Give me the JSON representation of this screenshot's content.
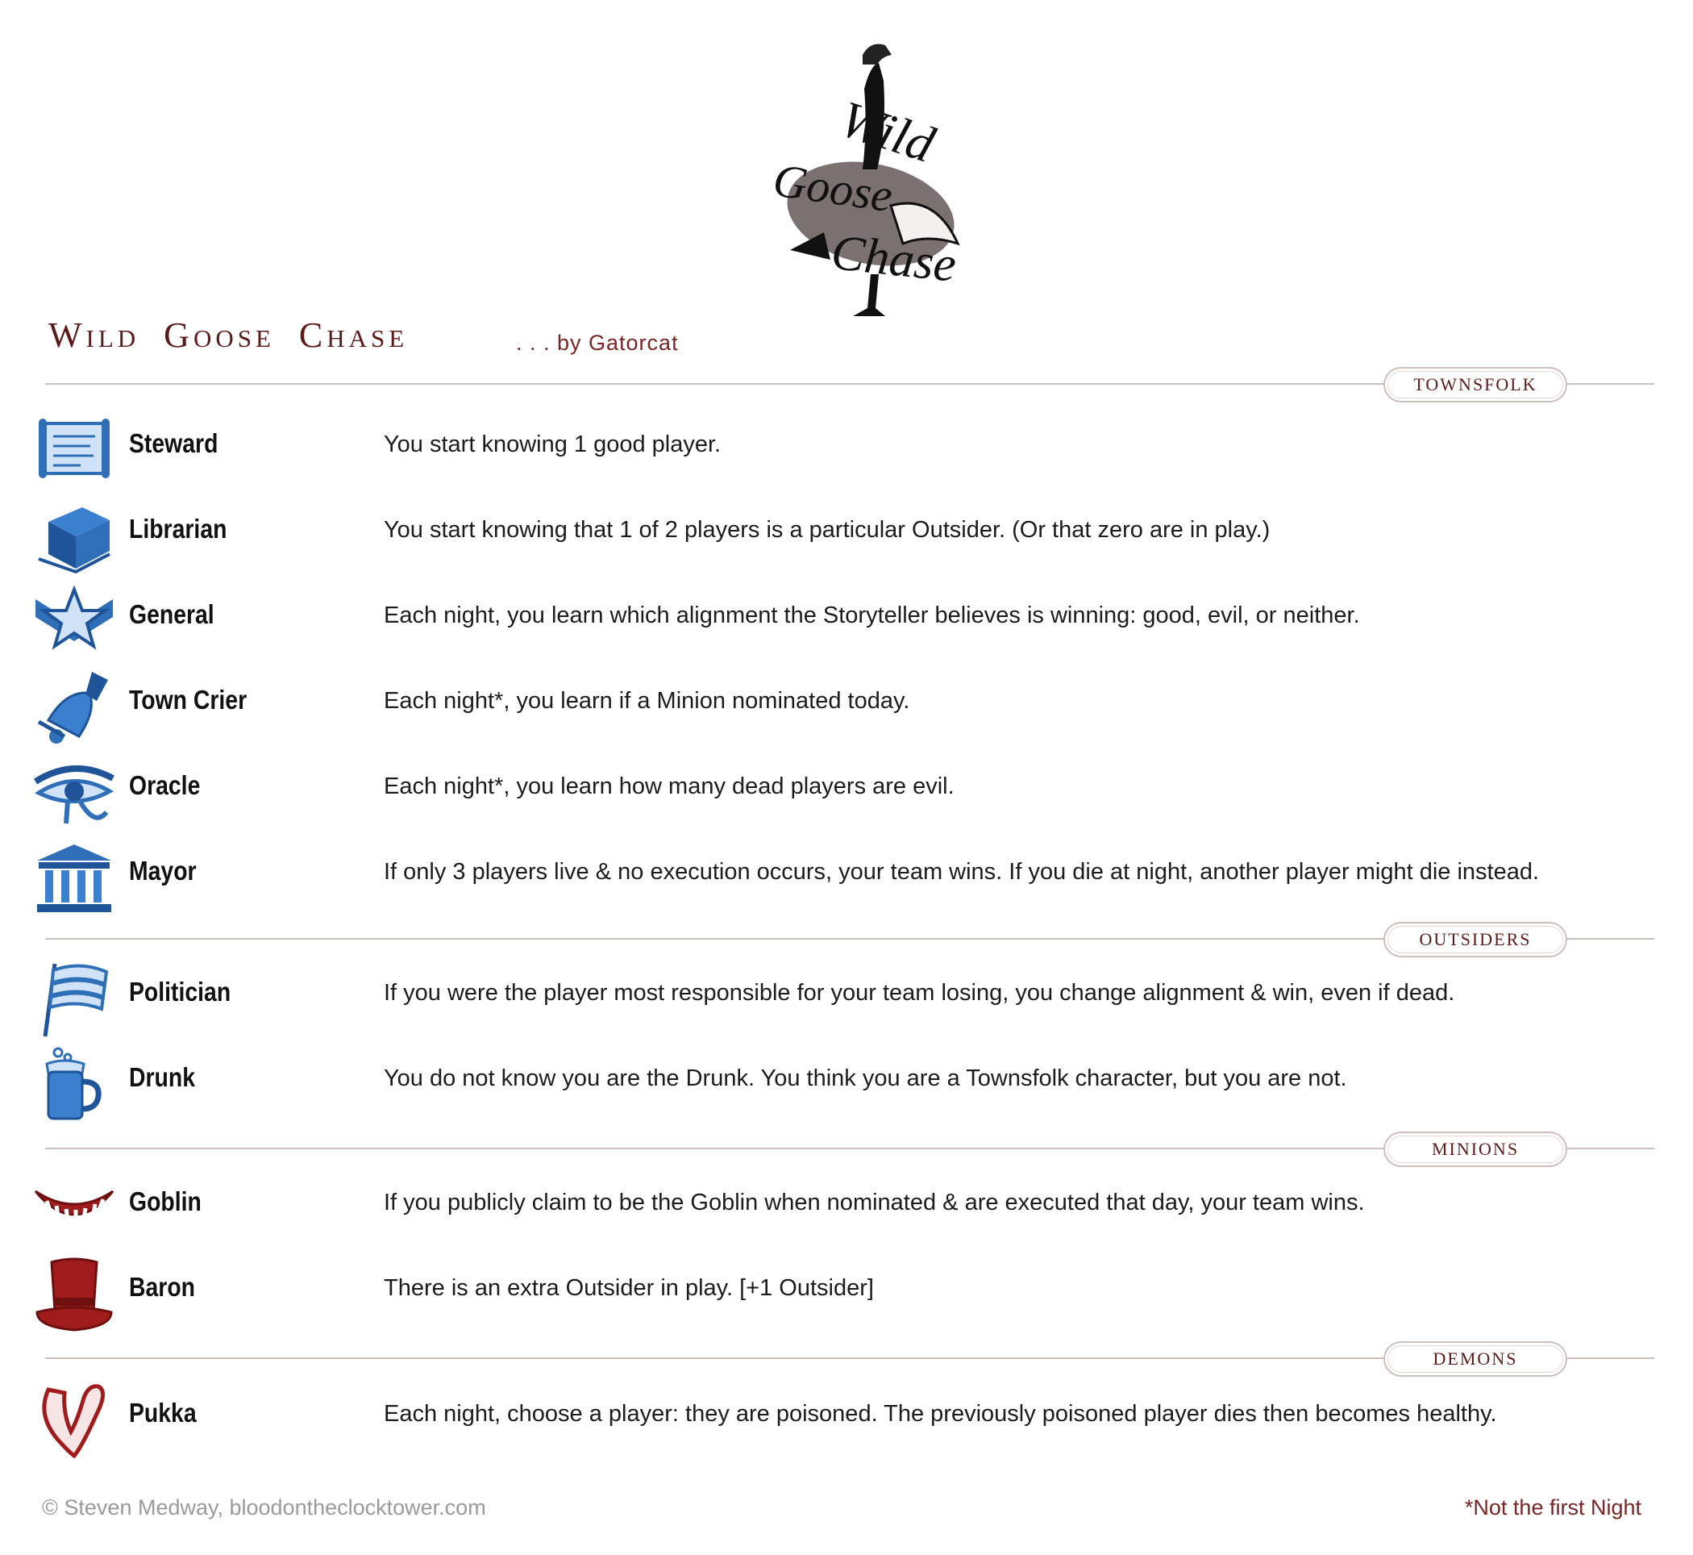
{
  "logo": {
    "text_lines": [
      "Wild",
      "Goose",
      "Chase"
    ]
  },
  "header": {
    "title": "Wild Goose Chase",
    "byline": ". . . by Gatorcat"
  },
  "teams": [
    {
      "label": "Townsfolk",
      "characters": [
        {
          "name": "Steward",
          "ability": "You start knowing 1 good player.",
          "icon": "scroll-icon",
          "color": "#2f6fb8"
        },
        {
          "name": "Librarian",
          "ability": "You start knowing that 1 of 2 players is a particular Outsider. (Or that zero are in play.)",
          "icon": "book-icon",
          "color": "#2f6fb8"
        },
        {
          "name": "General",
          "ability": "Each night, you learn which alignment the Storyteller believes is winning: good, evil, or neither.",
          "icon": "star-chevron-icon",
          "color": "#2f6fb8"
        },
        {
          "name": "Town Crier",
          "ability": "Each night*, you learn if a Minion nominated today.",
          "icon": "bell-icon",
          "color": "#2f6fb8"
        },
        {
          "name": "Oracle",
          "ability": "Each night*, you learn how many dead players are evil.",
          "icon": "eye-icon",
          "color": "#2f6fb8"
        },
        {
          "name": "Mayor",
          "ability": "If only 3 players live & no execution occurs, your team wins. If you die at night, another player might die instead.",
          "icon": "temple-icon",
          "color": "#2f6fb8"
        }
      ]
    },
    {
      "label": "Outsiders",
      "characters": [
        {
          "name": "Politician",
          "ability": "If you were the player most responsible for your team losing, you change alignment & win, even if dead.",
          "icon": "flag-icon",
          "color": "#2f6fb8"
        },
        {
          "name": "Drunk",
          "ability": "You do not know you are the Drunk. You think you are a Townsfolk character, but you are not.",
          "icon": "beer-mug-icon",
          "color": "#2f6fb8"
        }
      ]
    },
    {
      "label": "Minions",
      "characters": [
        {
          "name": "Goblin",
          "ability": "If you publicly claim to be the Goblin when nominated & are executed that day, your team wins.",
          "icon": "grin-icon",
          "color": "#a01c1c"
        },
        {
          "name": "Baron",
          "ability": "There is an extra Outsider in play. [+1 Outsider]",
          "icon": "top-hat-icon",
          "color": "#a01c1c"
        }
      ]
    },
    {
      "label": "Demons",
      "characters": [
        {
          "name": "Pukka",
          "ability": "Each night, choose a player: they are poisoned. The previously poisoned player dies then becomes healthy.",
          "icon": "fang-icon",
          "color": "#a01c1c"
        }
      ]
    }
  ],
  "footer": {
    "copyright": "© Steven Medway, bloodontheclocktower.com",
    "note": "*Not the first Night"
  }
}
